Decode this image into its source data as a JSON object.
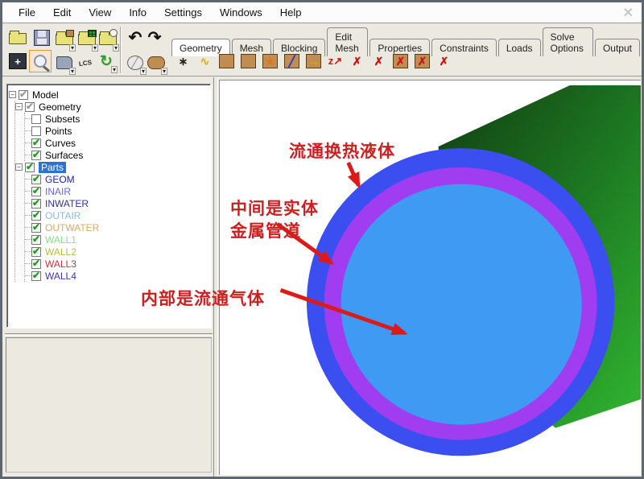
{
  "menu": {
    "items": [
      "File",
      "Edit",
      "View",
      "Info",
      "Settings",
      "Windows",
      "Help"
    ]
  },
  "window": {
    "close_glyph": "✕"
  },
  "tabs": {
    "items": [
      {
        "label": "Geometry",
        "active": true
      },
      {
        "label": "Mesh",
        "active": false
      },
      {
        "label": "Blocking",
        "active": false
      },
      {
        "label": "Edit Mesh",
        "active": false
      },
      {
        "label": "Properties",
        "active": false
      },
      {
        "label": "Constraints",
        "active": false
      },
      {
        "label": "Loads",
        "active": false
      },
      {
        "label": "Solve Options",
        "active": false
      },
      {
        "label": "Output",
        "active": false
      }
    ]
  },
  "glyphs": {
    "check": "✔",
    "dropdown": "▾",
    "undo": "↶",
    "redo": "↷",
    "minus": "−",
    "fit_plus": "+",
    "refresh": "↻",
    "lcs_label": "LCS"
  },
  "toolbar": {
    "geometry_tools": [
      {
        "name": "create-point",
        "glyph": "∗"
      },
      {
        "name": "create-modify-curve",
        "glyph": "∿"
      },
      {
        "name": "create-modify-surface",
        "glyph": ""
      },
      {
        "name": "create-body",
        "glyph": ""
      },
      {
        "name": "create-faceted",
        "glyph": "★"
      },
      {
        "name": "repair-geometry",
        "glyph": "╱"
      },
      {
        "name": "transform-geometry",
        "glyph": "→"
      },
      {
        "name": "restore-dormant",
        "glyph": "z↗"
      },
      {
        "name": "delete-point",
        "glyph": "✗"
      },
      {
        "name": "delete-curve",
        "glyph": "✗"
      },
      {
        "name": "delete-surface",
        "glyph": "✗"
      },
      {
        "name": "delete-body",
        "glyph": "✗"
      },
      {
        "name": "delete-any-entity",
        "glyph": "✗"
      }
    ]
  },
  "tree": {
    "root": {
      "label": "Model"
    },
    "geometry": {
      "label": "Geometry",
      "children": [
        {
          "label": "Subsets",
          "checked": false
        },
        {
          "label": "Points",
          "checked": false
        },
        {
          "label": "Curves",
          "checked": true
        },
        {
          "label": "Surfaces",
          "checked": true
        }
      ]
    },
    "parts": {
      "label": "Parts",
      "selected": true,
      "children": [
        {
          "label": "GEOM",
          "color": "#2222aa"
        },
        {
          "label": "INAIR",
          "color": "#6666dd"
        },
        {
          "label": "INWATER",
          "color": "#333399"
        },
        {
          "label": "OUTAIR",
          "color": "#88bbdd"
        },
        {
          "label": "OUTWATER",
          "color": "#ddaa66"
        },
        {
          "label": "WALL1",
          "color": "#88dd88"
        },
        {
          "label": "WALL2",
          "color": "#bbbb44"
        },
        {
          "label": "WALL3",
          "color": "#cc3333"
        },
        {
          "label": "WALL4",
          "color": "#4433aa"
        }
      ]
    }
  },
  "viewport": {
    "annotations": [
      {
        "lines": [
          "流通换热液体"
        ]
      },
      {
        "lines": [
          "中间是实体",
          "金属管道"
        ]
      },
      {
        "lines": [
          "内部是流通气体"
        ]
      }
    ],
    "colors": {
      "outer_liquid_ring": "#3b4ff0",
      "pipe_wall_ring": "#a03df0",
      "inner_gas_disc": "#3e9af2",
      "cylinder_dark_green": "#123d12",
      "cylinder_light_green": "#2fae2f",
      "annotation_red": "#cc2020"
    }
  }
}
